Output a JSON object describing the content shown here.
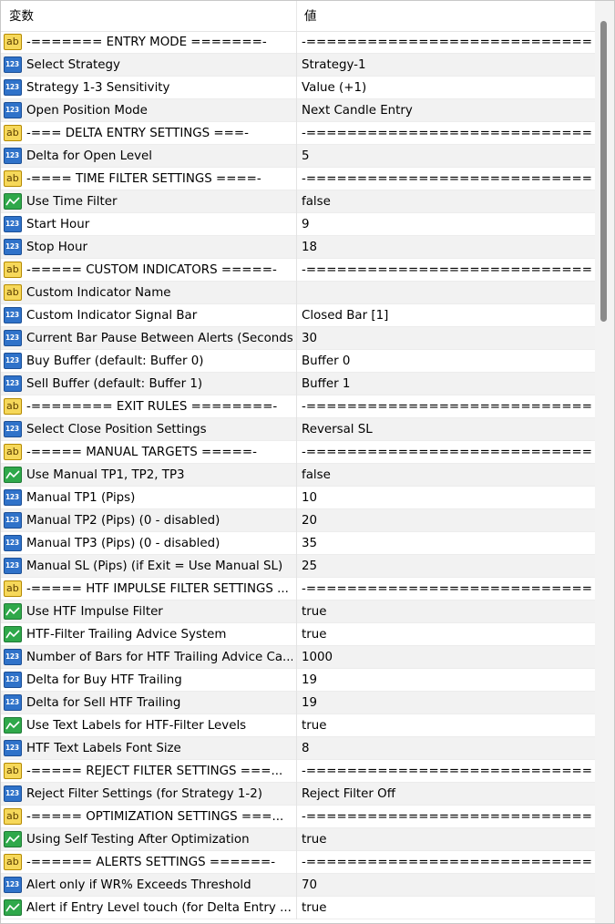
{
  "header": {
    "variable": "変数",
    "value": "値"
  },
  "rows": [
    {
      "type": "ab",
      "name": "-=======   ENTRY  MODE   =======-",
      "value": "-==============================..."
    },
    {
      "type": "num",
      "name": "Select Strategy",
      "value": "Strategy-1"
    },
    {
      "type": "num",
      "name": "Strategy 1-3 Sensitivity",
      "value": "Value (+1)"
    },
    {
      "type": "num",
      "name": "Open Position Mode",
      "value": "Next Candle Entry"
    },
    {
      "type": "ab",
      "name": "-=== DELTA ENTRY SETTINGS ===-",
      "value": "-==============================..."
    },
    {
      "type": "num",
      "name": "Delta for Open Level",
      "value": "5"
    },
    {
      "type": "ab",
      "name": "-==== TIME FILTER SETTINGS ====-",
      "value": "-==============================..."
    },
    {
      "type": "bool",
      "name": "Use Time Filter",
      "value": "false"
    },
    {
      "type": "num",
      "name": "Start Hour",
      "value": "9"
    },
    {
      "type": "num",
      "name": "Stop Hour",
      "value": "18"
    },
    {
      "type": "ab",
      "name": "-=====  CUSTOM INDICATORS  =====-",
      "value": "-==============================..."
    },
    {
      "type": "ab",
      "name": "Custom Indicator Name",
      "value": ""
    },
    {
      "type": "num",
      "name": "Custom Indicator Signal Bar",
      "value": "Closed Bar [1]"
    },
    {
      "type": "num",
      "name": "Current Bar Pause Between Alerts (Seconds)",
      "value": "30"
    },
    {
      "type": "num",
      "name": "Buy Buffer (default: Buffer 0)",
      "value": "Buffer 0"
    },
    {
      "type": "num",
      "name": "Sell Buffer (default: Buffer 1)",
      "value": "Buffer 1"
    },
    {
      "type": "ab",
      "name": "-========   EXIT  RULES   ========-",
      "value": "-==============================..."
    },
    {
      "type": "num",
      "name": "Select Close Position Settings",
      "value": "Reversal SL"
    },
    {
      "type": "ab",
      "name": "-=====   MANUAL TARGETS   =====-",
      "value": "-==============================..."
    },
    {
      "type": "bool",
      "name": "Use Manual TP1, TP2, TP3",
      "value": "false"
    },
    {
      "type": "num",
      "name": "Manual TP1 (Pips)",
      "value": "10"
    },
    {
      "type": "num",
      "name": "Manual TP2 (Pips) (0 - disabled)",
      "value": "20"
    },
    {
      "type": "num",
      "name": "Manual TP3 (Pips) (0 - disabled)",
      "value": "35"
    },
    {
      "type": "num",
      "name": "Manual SL (Pips) (if Exit = Use Manual SL)",
      "value": "25"
    },
    {
      "type": "ab",
      "name": "-=====   HTF IMPULSE FILTER SETTINGS  ...",
      "value": "-==============================..."
    },
    {
      "type": "bool",
      "name": "Use HTF Impulse Filter",
      "value": "true"
    },
    {
      "type": "bool",
      "name": "HTF-Filter Trailing Advice System",
      "value": "true"
    },
    {
      "type": "num",
      "name": "Number of Bars for HTF Trailing Advice Ca...",
      "value": "1000"
    },
    {
      "type": "num",
      "name": "Delta for Buy HTF Trailing",
      "value": "19"
    },
    {
      "type": "num",
      "name": "Delta for Sell HTF Trailing",
      "value": "19"
    },
    {
      "type": "bool",
      "name": "Use Text Labels for HTF-Filter Levels",
      "value": "true"
    },
    {
      "type": "num",
      "name": "HTF Text Labels Font Size",
      "value": "8"
    },
    {
      "type": "ab",
      "name": "-=====   REJECT FILTER SETTINGS   ===...",
      "value": "-==============================..."
    },
    {
      "type": "num",
      "name": "Reject Filter Settings (for Strategy 1-2)",
      "value": "Reject Filter Off"
    },
    {
      "type": "ab",
      "name": "-=====   OPTIMIZATION SETTINGS   ===...",
      "value": "-==============================..."
    },
    {
      "type": "bool",
      "name": "Using Self Testing After Optimization",
      "value": "true"
    },
    {
      "type": "ab",
      "name": "-======  ALERTS SETTINGS  ======-",
      "value": "-==============================..."
    },
    {
      "type": "num",
      "name": "Alert only if WR% Exceeds Threshold",
      "value": "70"
    },
    {
      "type": "bool",
      "name": "Alert if Entry Level touch (for Delta Entry ...",
      "value": "true"
    }
  ],
  "icons": {
    "ab": {
      "name": "string-type-icon",
      "glyph": "ab",
      "color": "#f6d85a"
    },
    "num": {
      "name": "integer-type-icon",
      "glyph": "123",
      "color": "#2f72c9"
    },
    "bool": {
      "name": "boolean-type-icon",
      "color": "#2fa84a"
    }
  }
}
